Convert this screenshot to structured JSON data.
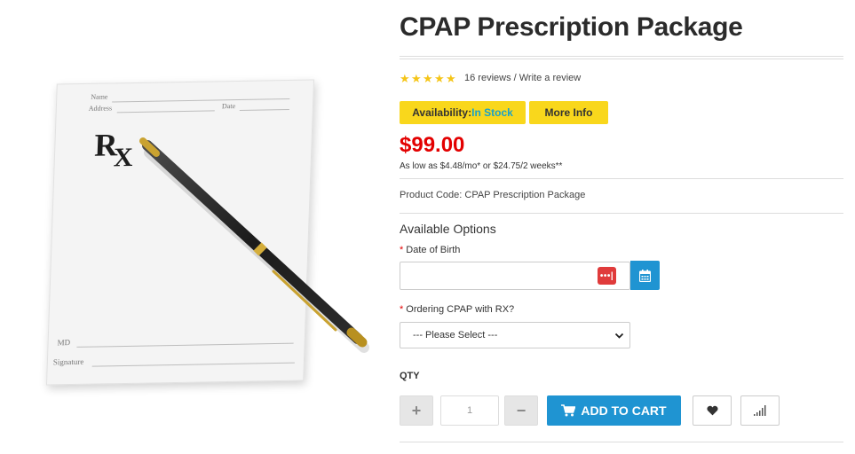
{
  "product": {
    "title": "CPAP Prescription Package",
    "reviews_text": "16 reviews",
    "review_separator": " / ",
    "write_review_text": "Write a review",
    "rating": 5,
    "availability_label": "Availability:",
    "availability_value": "In Stock",
    "more_info_label": "More Info",
    "price": "$99.00",
    "finance_text": "As low as $4.48/mo* or $24.75/2 weeks**",
    "product_code_text": "Product Code: CPAP Prescription Package"
  },
  "rx_paper": {
    "name_label": "Name",
    "address_label": "Address",
    "date_label": "Date",
    "rx_letters": "R",
    "rx_sub": "X",
    "md_label": "MD",
    "signature_label": "Signature"
  },
  "options": {
    "heading": "Available Options",
    "required_mark": "*",
    "dob_label": "Date of Birth",
    "dob_value": "",
    "dots_icon_text": "•••|",
    "ordering_label": "Ordering CPAP with RX?",
    "ordering_selected": "--- Please Select ---"
  },
  "cart": {
    "qty_label": "QTY",
    "plus_symbol": "+",
    "minus_symbol": "−",
    "qty_value": "1",
    "add_to_cart_label": "ADD TO CART"
  },
  "icons": {
    "calendar": "calendar-icon",
    "cart": "shopping-cart-icon",
    "wishlist": "heart-icon",
    "compare": "bar-chart-icon"
  },
  "colors": {
    "accent_blue": "#1f94d2",
    "badge_yellow": "#f9d71c",
    "price_red": "#e30000",
    "star_gold": "#f5c518",
    "in_stock_blue": "#1aa1c9"
  }
}
